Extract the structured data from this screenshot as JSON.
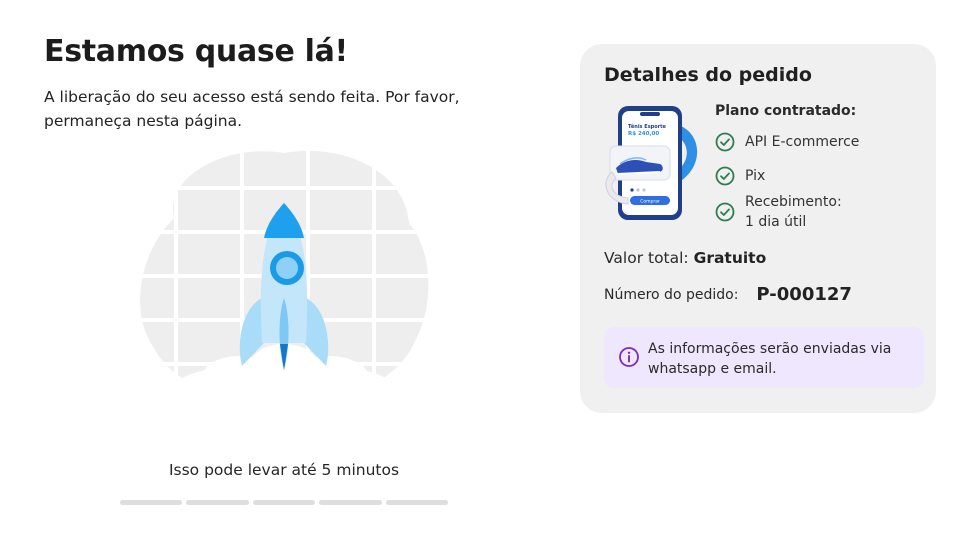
{
  "main": {
    "title": "Estamos quase lá!",
    "subtitle": "A liberação do seu acesso está sendo feita. Por favor, permaneça nesta página.",
    "illustration_icon": "rocket-launch-icon",
    "wait_text": "Isso pode levar até 5 minutos",
    "progress": {
      "segments": 5,
      "completed": 0
    }
  },
  "order_details": {
    "title": "Detalhes do pedido",
    "image_icon": "phone-shopping-illustration",
    "phone_product_title": "Tênis Esporte",
    "phone_product_price": "R$ 240,00",
    "phone_button_label": "Comprar",
    "plan_label": "Plano contratado:",
    "plan_items": [
      {
        "icon": "check-circle-icon",
        "label": "API E-commerce"
      },
      {
        "icon": "check-circle-icon",
        "label": "Pix"
      },
      {
        "icon": "check-circle-icon",
        "label": "Recebimento:\n1 dia útil"
      }
    ],
    "total_label": "Valor total:",
    "total_value": "Gratuito",
    "order_number_label": "Número do pedido:",
    "order_number_value": "P-000127",
    "info_icon": "info-icon",
    "info_text": "As informações serão enviadas via whatsapp e email."
  },
  "colors": {
    "check_green": "#2e7d4f",
    "info_purple": "#7b2cbf",
    "info_background": "#eee7fd",
    "card_background": "#f0f0f0",
    "rocket_blue": "#2196f3"
  }
}
